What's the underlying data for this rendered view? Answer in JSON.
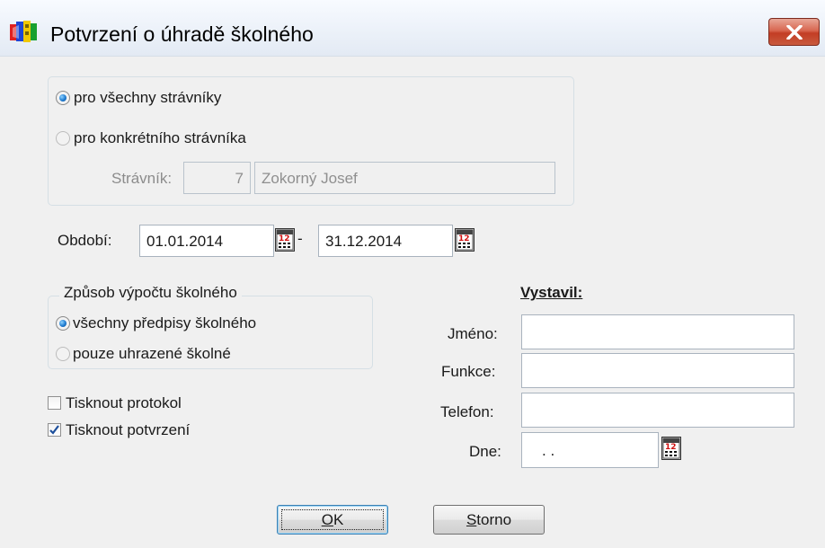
{
  "window": {
    "title": "Potvrzení o úhradě školného"
  },
  "scope": {
    "option_all": "pro všechny strávníky",
    "option_single": "pro konkrétního strávníka",
    "selected": "all",
    "diner_label": "Strávník:",
    "diner_id": "7",
    "diner_name": "Zokorný Josef"
  },
  "period": {
    "label": "Období:",
    "from": "01.01.2014",
    "separator": "-",
    "to": "31.12.2014"
  },
  "calculation": {
    "legend": "Způsob výpočtu školného",
    "option_all": "všechny předpisy školného",
    "option_paid": "pouze uhrazené školné",
    "selected": "all"
  },
  "print_options": {
    "protocol_label": "Tisknout protokol",
    "protocol_checked": false,
    "confirmation_label": "Tisknout potvrzení",
    "confirmation_checked": true
  },
  "issuer": {
    "heading": "Vystavil:",
    "name_label": "Jméno:",
    "name_value": "",
    "function_label": "Funkce:",
    "function_value": "",
    "phone_label": "Telefon:",
    "phone_value": "",
    "date_label": "Dne:",
    "date_value": ". ."
  },
  "buttons": {
    "ok_label": "OK",
    "ok_mnemonic": "O",
    "cancel_label": "Storno",
    "cancel_mnemonic": "S"
  },
  "icons": {
    "app": "app-icon",
    "close": "close-icon",
    "calendar": "calendar-icon"
  },
  "colors": {
    "close_button": "#c83b22",
    "radio_selected": "#1f7bd0",
    "dialog_background": "#f0f0f0"
  }
}
